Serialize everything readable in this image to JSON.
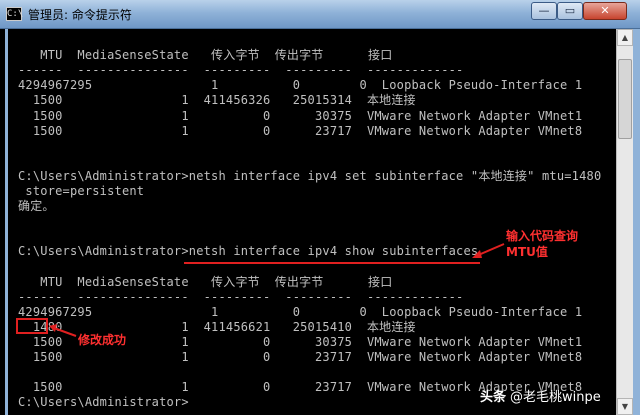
{
  "window": {
    "icon_text": "C:\\",
    "title": "管理员: 命令提示符",
    "min_label": "—",
    "max_label": "▭",
    "close_label": "✕"
  },
  "console": {
    "lines": [
      "",
      "   MTU  MediaSenseState   传入字节  传出字节      接口",
      "------  ---------------  ---------  ---------  -------------",
      "4294967295                1          0        0  Loopback Pseudo-Interface 1",
      "  1500                1  411456326   25015314  本地连接",
      "  1500                1          0      30375  VMware Network Adapter VMnet1",
      "  1500                1          0      23717  VMware Network Adapter VMnet8",
      "",
      "",
      "C:\\Users\\Administrator>netsh interface ipv4 set subinterface \"本地连接\" mtu=1480",
      " store=persistent",
      "确定。",
      "",
      "",
      "C:\\Users\\Administrator>netsh interface ipv4 show subinterfaces",
      "",
      "   MTU  MediaSenseState   传入字节  传出字节      接口",
      "------  ---------------  ---------  ---------  -------------",
      "4294967295                1          0        0  Loopback Pseudo-Interface 1",
      "  1480                1  411456621   25015410  本地连接",
      "  1500                1          0      30375  VMware Network Adapter VMnet1",
      "  1500                1          0      23717  VMware Network Adapter VMnet8",
      "",
      "  1500                1          0      23717  VMware Network Adapter VMnet8",
      "C:\\Users\\Administrator>"
    ]
  },
  "annotations": {
    "query_note": "输入代码查询\nMTU值",
    "success_note": "修改成功",
    "color": "#ff3030"
  },
  "watermark": {
    "logo": "头条",
    "text": "@老毛桃winpe"
  },
  "colors": {
    "console_bg": "#000000",
    "console_text": "#c0c0c0",
    "titlebar": "#8fb2d8"
  }
}
